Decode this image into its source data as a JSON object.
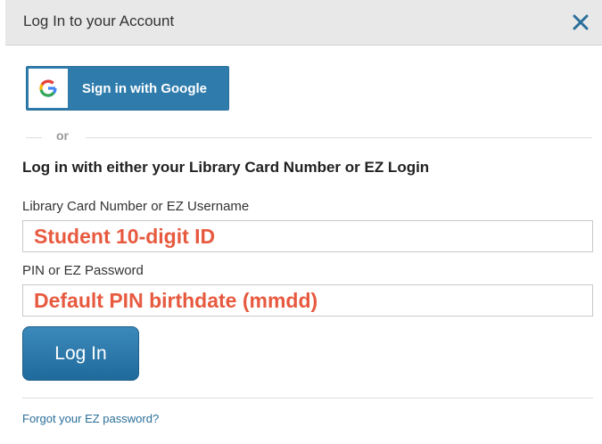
{
  "dialog": {
    "title": "Log In to your Account",
    "close_icon": "close-icon"
  },
  "google": {
    "button_label": "Sign in with Google",
    "icon": "google-g-icon"
  },
  "separator": {
    "text": "or"
  },
  "form": {
    "heading": "Log in with either your Library Card Number or EZ Login",
    "card_label": "Library Card Number or EZ Username",
    "card_value": "Student 10-digit ID",
    "pin_label": "PIN or EZ Password",
    "pin_value": "Default PIN birthdate (mmdd)",
    "submit_label": "Log In"
  },
  "footer": {
    "forgot_link": "Forgot your EZ password?"
  },
  "colors": {
    "accent": "#2f7cac",
    "annotation": "#e75a3f"
  }
}
